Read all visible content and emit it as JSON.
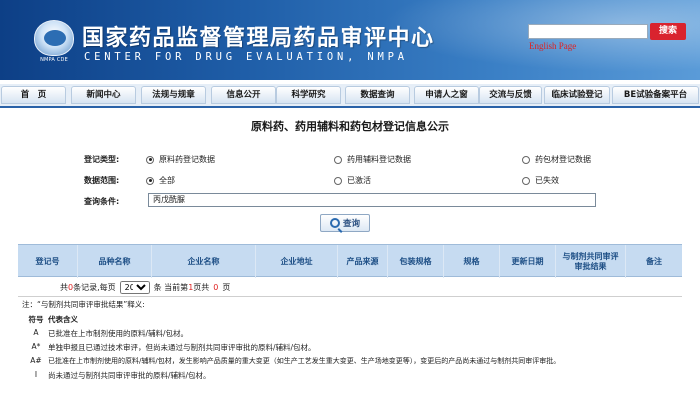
{
  "header": {
    "title_cn": "国家药品监督管理局药品审评中心",
    "title_en": "CENTER FOR DRUG EVALUATION, NMPA",
    "logo_text": "NMPA CDE",
    "search_button": "搜索",
    "english_link": "English Page"
  },
  "nav": {
    "items": [
      {
        "label": "首　页"
      },
      {
        "label": "新闻中心"
      },
      {
        "label": "法规与规章"
      },
      {
        "label": "信息公开"
      },
      {
        "label": "科学研究"
      },
      {
        "label": "数据查询"
      },
      {
        "label": "申请人之窗"
      },
      {
        "label": "交流与反馈"
      },
      {
        "label": "临床试验登记"
      },
      {
        "label": "BE试验备案平台"
      }
    ]
  },
  "page": {
    "title": "原料药、药用辅料和药包材登记信息公示"
  },
  "form": {
    "type_label": "登记类型:",
    "type_options": [
      "原料药登记数据",
      "药用辅料登记数据",
      "药包材登记数据"
    ],
    "scope_label": "数据范围:",
    "scope_options": [
      "全部",
      "已激活",
      "已失效"
    ],
    "condition_label": "查询条件:",
    "condition_value": "丙戊酰脲",
    "query_button": "查询"
  },
  "table": {
    "columns": [
      "登记号",
      "品种名称",
      "企业名称",
      "企业地址",
      "产品来源",
      "包装规格",
      "规格",
      "更新日期",
      "与制剂共同审评审批结果",
      "备注"
    ]
  },
  "pager": {
    "prefix": "共",
    "total": "0",
    "middle": "条记录,每页",
    "page_size": "20",
    "current_prefix": "条  当前第",
    "current_page": "1",
    "page_suffix": "页共",
    "total_pages": "0",
    "end": "页"
  },
  "notes": {
    "title": "注：“与制剂共同审评审批结果”释义:",
    "symbol_header": "符号",
    "meaning_header": "代表含义",
    "legend": [
      {
        "symbol": "A",
        "text": "已批准在上市制剂使用的原料/辅料/包材。"
      },
      {
        "symbol": "A*",
        "text": "单独申报且已通过技术审评，但尚未通过与制剂共同审评审批的原料/辅料/包材。"
      },
      {
        "symbol": "A#",
        "text": "已批准在上市制剂使用的原料/辅料/包材，发生影响产品质量的重大变更（如生产工艺发生重大变更、生产场地变更等），变更后的产品尚未通过与制剂共同审评审批。"
      },
      {
        "symbol": "I",
        "text": "尚未通过与制剂共同审评审批的原料/辅料/包材。"
      }
    ]
  }
}
